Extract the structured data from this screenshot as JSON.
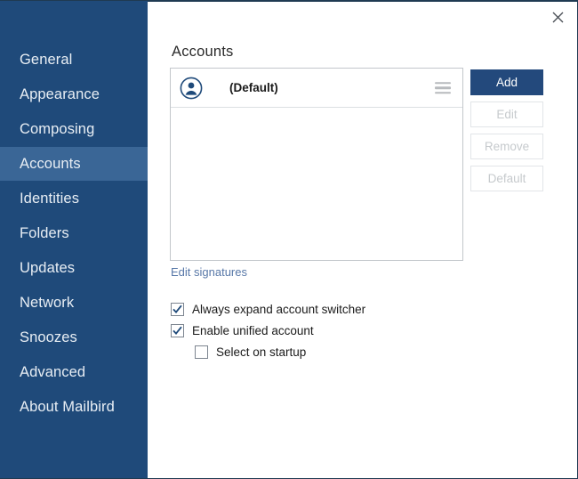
{
  "window": {
    "close_label": "×",
    "close_icon": "close-icon"
  },
  "sidebar": {
    "background_color": "#1f4a7a",
    "selected_color": "#3a6696",
    "items": [
      {
        "label": "General",
        "selected": false
      },
      {
        "label": "Appearance",
        "selected": false
      },
      {
        "label": "Composing",
        "selected": false
      },
      {
        "label": "Accounts",
        "selected": true
      },
      {
        "label": "Identities",
        "selected": false
      },
      {
        "label": "Folders",
        "selected": false
      },
      {
        "label": "Updates",
        "selected": false
      },
      {
        "label": "Network",
        "selected": false
      },
      {
        "label": "Snoozes",
        "selected": false
      },
      {
        "label": "Advanced",
        "selected": false
      },
      {
        "label": "About Mailbird",
        "selected": false
      }
    ]
  },
  "main": {
    "title": "Accounts",
    "accounts": [
      {
        "name": "(Default)",
        "avatar_icon": "account-avatar-icon",
        "menu_icon": "hamburger-menu-icon"
      }
    ],
    "buttons": [
      {
        "label": "Add",
        "state": "enabled"
      },
      {
        "label": "Edit",
        "state": "disabled"
      },
      {
        "label": "Remove",
        "state": "disabled"
      },
      {
        "label": "Default",
        "state": "disabled"
      }
    ],
    "primary_button_color": "#23497c",
    "link": {
      "label": "Edit signatures",
      "color": "#5878a8"
    },
    "checkboxes": [
      {
        "label": "Always expand account switcher",
        "checked": true,
        "indent": false
      },
      {
        "label": "Enable unified account",
        "checked": true,
        "indent": false
      },
      {
        "label": "Select on startup",
        "checked": false,
        "indent": true
      }
    ],
    "checkbox_accent_color": "#1f4a7a"
  }
}
